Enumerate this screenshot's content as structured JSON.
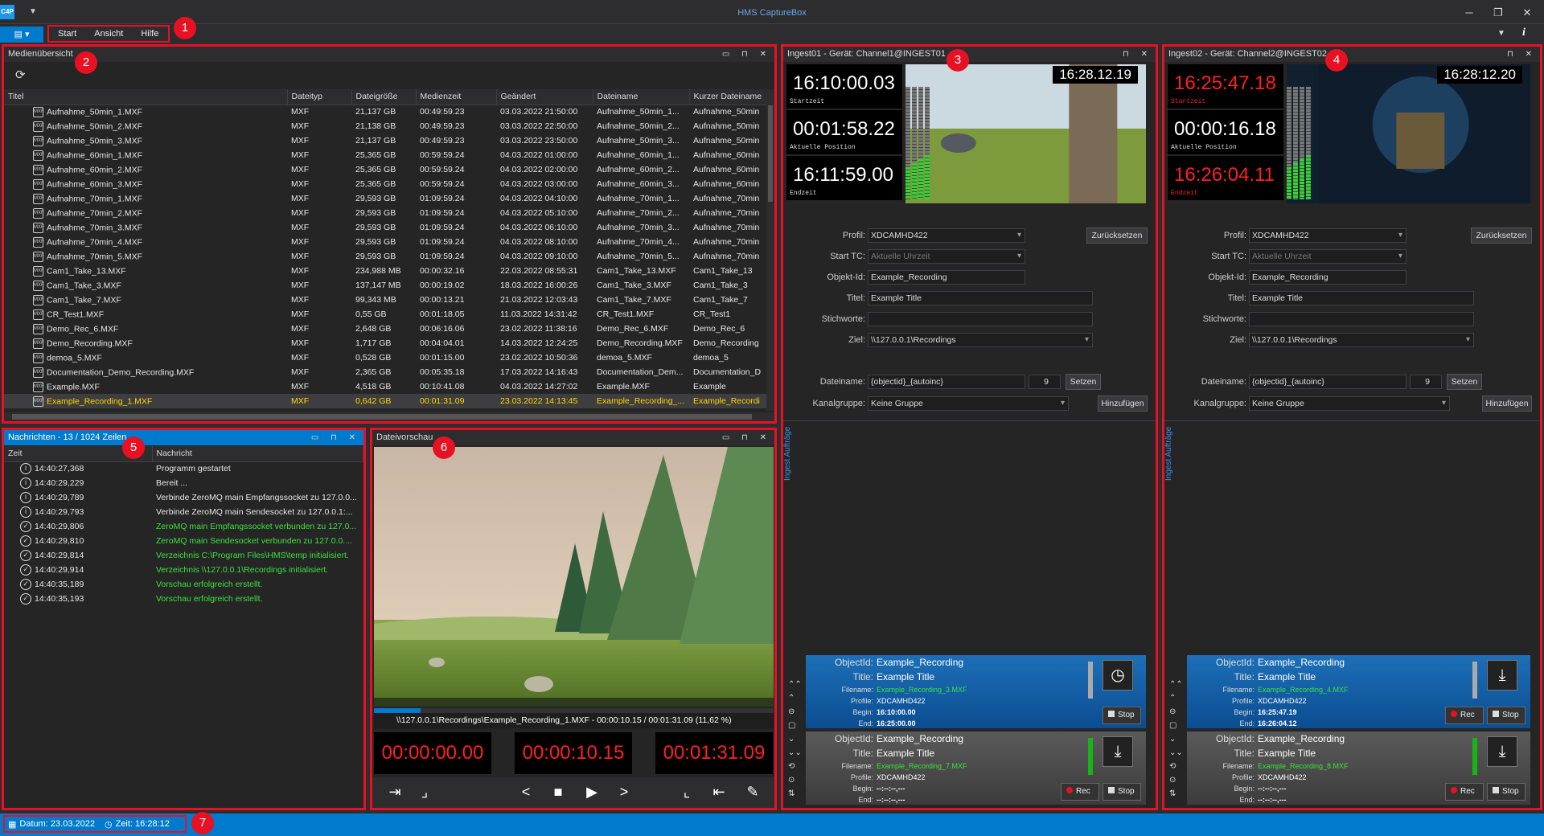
{
  "window": {
    "title": "HMS CaptureBox",
    "app_icon": "C4P",
    "qa": "▼"
  },
  "menu": {
    "items": [
      "Start",
      "Ansicht",
      "Hilfe"
    ]
  },
  "badges": [
    "1",
    "2",
    "3",
    "4",
    "5",
    "6",
    "7"
  ],
  "media": {
    "title": "Medienübersicht",
    "columns": [
      "Titel",
      "Dateityp",
      "Dateigröße",
      "Medienzeit",
      "Geändert",
      "Dateiname",
      "Kurzer Dateiname"
    ],
    "rows": [
      [
        "Aufnahme_50min_1.MXF",
        "MXF",
        "21,137 GB",
        "00:49:59.23",
        "03.03.2022 21:50:00",
        "Aufnahme_50min_1...",
        "Aufnahme_50min"
      ],
      [
        "Aufnahme_50min_2.MXF",
        "MXF",
        "21,138 GB",
        "00:49:59.23",
        "03.03.2022 22:50:00",
        "Aufnahme_50min_2...",
        "Aufnahme_50min"
      ],
      [
        "Aufnahme_50min_3.MXF",
        "MXF",
        "21,137 GB",
        "00:49:59.23",
        "03.03.2022 23:50:00",
        "Aufnahme_50min_3...",
        "Aufnahme_50min"
      ],
      [
        "Aufnahme_60min_1.MXF",
        "MXF",
        "25,365 GB",
        "00:59:59.24",
        "04.03.2022 01:00:00",
        "Aufnahme_60min_1...",
        "Aufnahme_60min"
      ],
      [
        "Aufnahme_60min_2.MXF",
        "MXF",
        "25,365 GB",
        "00:59:59.24",
        "04.03.2022 02:00:00",
        "Aufnahme_60min_2...",
        "Aufnahme_60min"
      ],
      [
        "Aufnahme_60min_3.MXF",
        "MXF",
        "25,365 GB",
        "00:59:59.24",
        "04.03.2022 03:00:00",
        "Aufnahme_60min_3...",
        "Aufnahme_60min"
      ],
      [
        "Aufnahme_70min_1.MXF",
        "MXF",
        "29,593 GB",
        "01:09:59.24",
        "04.03.2022 04:10:00",
        "Aufnahme_70min_1...",
        "Aufnahme_70min"
      ],
      [
        "Aufnahme_70min_2.MXF",
        "MXF",
        "29,593 GB",
        "01:09:59.24",
        "04.03.2022 05:10:00",
        "Aufnahme_70min_2...",
        "Aufnahme_70min"
      ],
      [
        "Aufnahme_70min_3.MXF",
        "MXF",
        "29,593 GB",
        "01:09:59.24",
        "04.03.2022 06:10:00",
        "Aufnahme_70min_3...",
        "Aufnahme_70min"
      ],
      [
        "Aufnahme_70min_4.MXF",
        "MXF",
        "29,593 GB",
        "01:09:59.24",
        "04.03.2022 08:10:00",
        "Aufnahme_70min_4...",
        "Aufnahme_70min"
      ],
      [
        "Aufnahme_70min_5.MXF",
        "MXF",
        "29,593 GB",
        "01:09:59.24",
        "04.03.2022 09:10:00",
        "Aufnahme_70min_5...",
        "Aufnahme_70min"
      ],
      [
        "Cam1_Take_13.MXF",
        "MXF",
        "234,988 MB",
        "00:00:32.16",
        "22.03.2022 08:55:31",
        "Cam1_Take_13.MXF",
        "Cam1_Take_13"
      ],
      [
        "Cam1_Take_3.MXF",
        "MXF",
        "137,147 MB",
        "00:00:19.02",
        "18.03.2022 16:00:26",
        "Cam1_Take_3.MXF",
        "Cam1_Take_3"
      ],
      [
        "Cam1_Take_7.MXF",
        "MXF",
        "99,343 MB",
        "00:00:13.21",
        "21.03.2022 12:03:43",
        "Cam1_Take_7.MXF",
        "Cam1_Take_7"
      ],
      [
        "CR_Test1.MXF",
        "MXF",
        "0,55 GB",
        "00:01:18.05",
        "11.03.2022 14:31:42",
        "CR_Test1.MXF",
        "CR_Test1"
      ],
      [
        "Demo_Rec_6.MXF",
        "MXF",
        "2,648 GB",
        "00:06:16.06",
        "23.02.2022 11:38:16",
        "Demo_Rec_6.MXF",
        "Demo_Rec_6"
      ],
      [
        "Demo_Recording.MXF",
        "MXF",
        "1,717 GB",
        "00:04:04.01",
        "14.03.2022 12:24:25",
        "Demo_Recording.MXF",
        "Demo_Recording"
      ],
      [
        "demoa_5.MXF",
        "MXF",
        "0,528 GB",
        "00:01:15.00",
        "23.02.2022 10:50:36",
        "demoa_5.MXF",
        "demoa_5"
      ],
      [
        "Documentation_Demo_Recording.MXF",
        "MXF",
        "2,365 GB",
        "00:05:35.18",
        "17.03.2022 14:16:43",
        "Documentation_Dem...",
        "Documentation_D"
      ],
      [
        "Example.MXF",
        "MXF",
        "4,518 GB",
        "00:10:41.08",
        "04.03.2022 14:27:02",
        "Example.MXF",
        "Example"
      ],
      [
        "Example_Recording_1.MXF",
        "MXF",
        "0,642 GB",
        "00:01:31.09",
        "23.03.2022 14:13:45",
        "Example_Recording_...",
        "Example_Recordi"
      ]
    ]
  },
  "messages": {
    "title": "Nachrichten - 13 / 1024 Zeilen",
    "columns": [
      "Zeit",
      "Nachricht"
    ],
    "rows": [
      {
        "time": "14:40:27,368",
        "text": "Programm gestartet",
        "ok": false
      },
      {
        "time": "14:40:29,229",
        "text": "Bereit ...",
        "ok": false
      },
      {
        "time": "14:40:29,789",
        "text": "Verbinde ZeroMQ main Empfangssocket zu 127.0.0...",
        "ok": false
      },
      {
        "time": "14:40:29,793",
        "text": "Verbinde ZeroMQ main Sendesocket zu 127.0.0.1:...",
        "ok": false
      },
      {
        "time": "14:40:29,806",
        "text": "ZeroMQ main Empfangssocket verbunden zu 127.0...",
        "ok": true
      },
      {
        "time": "14:40:29,810",
        "text": "ZeroMQ main Sendesocket verbunden zu 127.0.0....",
        "ok": true
      },
      {
        "time": "14:40:29,814",
        "text": "Verzeichnis C:\\Program Files\\HMS\\temp initialisiert.",
        "ok": true
      },
      {
        "time": "14:40:29,914",
        "text": "Verzeichnis \\\\127.0.0.1\\Recordings initialisiert.",
        "ok": true
      },
      {
        "time": "14:40:35,189",
        "text": "Vorschau erfolgreich erstellt.",
        "ok": true
      },
      {
        "time": "14:40:35,193",
        "text": "Vorschau erfolgreich erstellt.",
        "ok": true
      }
    ]
  },
  "preview": {
    "title": "Dateivorschau",
    "path": "\\\\127.0.0.1\\Recordings\\Example_Recording_1.MXF - 00:00:10.15 / 00:01:31.09 (11,62 %)",
    "progress_percent": 11.62,
    "tc_start": "00:00:00.00",
    "tc_current": "00:00:10.15",
    "tc_end": "00:01:31.09"
  },
  "ingest1": {
    "title": "Ingest01 - Gerät: Channel1@INGEST01",
    "start": "16:10:00.03",
    "start_label": "Startzeit",
    "pos": "00:01:58.22",
    "pos_label": "Aktuelle Position",
    "end": "16:11:59.00",
    "end_label": "Endzeit",
    "overlay": "16:28.12.19",
    "profil": "XDCAMHD422",
    "starttc": "Aktuelle Uhrzeit",
    "objektid": "Example_Recording",
    "titel": "Example Title",
    "stichworte": "",
    "ziel": "\\\\127.0.0.1\\Recordings",
    "dateiname": "{objectid}_{autoinc}",
    "counter": "9",
    "kanalgruppe": "Keine Gruppe",
    "side_tab": "Ingest Aufträge",
    "jobs": [
      {
        "objectid": "Example_Recording",
        "title": "Example Title",
        "filename": "Example_Recording_3.MXF",
        "profile": "XDCAMHD422",
        "begin": "16:10:00.00",
        "end": "16:25:00.00",
        "icon": "clock-icon",
        "active": true
      },
      {
        "objectid": "Example_Recording",
        "title": "Example Title",
        "filename": "Example_Recording_7.MXF",
        "profile": "XDCAMHD422",
        "begin": "--:--:--,---",
        "end": "--:--:--,---",
        "icon": "download-icon",
        "active": false
      }
    ]
  },
  "ingest2": {
    "title": "Ingest02 - Gerät: Channel2@INGEST02",
    "start": "16:25:47.18",
    "start_label": "Startzeit",
    "pos": "00:00:16.18",
    "pos_label": "Aktuelle Position",
    "end": "16:26:04.11",
    "end_label": "Endzeit",
    "overlay": "16:28:12.20",
    "profil": "XDCAMHD422",
    "starttc": "Aktuelle Uhrzeit",
    "objektid": "Example_Recording",
    "titel": "Example Title",
    "stichworte": "",
    "ziel": "\\\\127.0.0.1\\Recordings",
    "dateiname": "{objectid}_{autoinc}",
    "counter": "9",
    "kanalgruppe": "Keine Gruppe",
    "side_tab": "Ingest Aufträge",
    "jobs": [
      {
        "objectid": "Example_Recording",
        "title": "Example Title",
        "filename": "Example_Recording_4.MXF",
        "profile": "XDCAMHD422",
        "begin": "16:25:47.19",
        "end": "16:26:04.12",
        "icon": "download-icon",
        "active": true
      },
      {
        "objectid": "Example_Recording",
        "title": "Example Title",
        "filename": "Example_Recording_8.MXF",
        "profile": "XDCAMHD422",
        "begin": "--:--:--,---",
        "end": "--:--:--,---",
        "icon": "download-icon",
        "active": false
      }
    ]
  },
  "form_labels": {
    "profil": "Profil:",
    "starttc": "Start TC:",
    "objektid": "Objekt-Id:",
    "titel": "Titel:",
    "stichworte": "Stichworte:",
    "ziel": "Ziel:",
    "dateiname": "Dateiname:",
    "kanalgruppe": "Kanalgruppe:",
    "reset": "Zurücksetzen",
    "setzen": "Setzen",
    "hinzufuegen": "Hinzufügen"
  },
  "job_labels": {
    "objectid": "ObjectId:",
    "title": "Title:",
    "filename": "Filename:",
    "profile": "Profile:",
    "begin": "Begin:",
    "end": "End:",
    "rec": "Rec",
    "stop": "Stop"
  },
  "status": {
    "date": "Datum: 23.03.2022",
    "time": "Zeit: 16:28:12"
  }
}
